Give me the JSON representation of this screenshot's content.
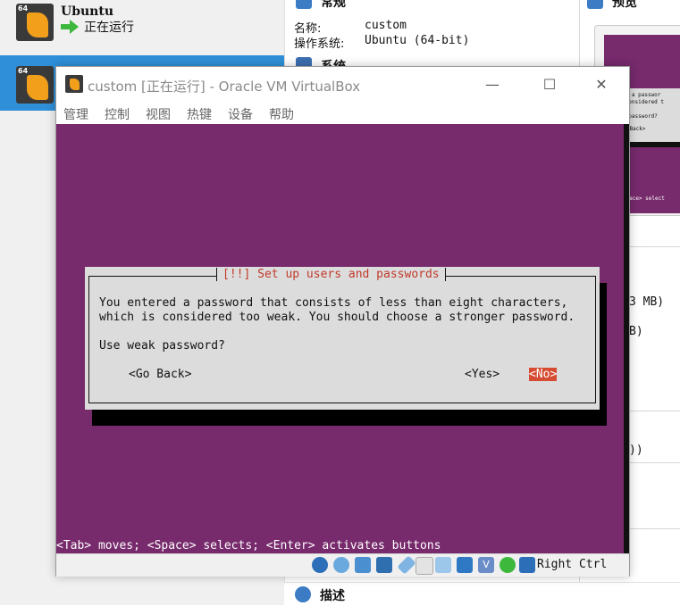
{
  "manager": {
    "vm_list": [
      {
        "name": "Ubuntu",
        "status": "正在运行",
        "badge": "64"
      },
      {
        "badge": "64"
      }
    ],
    "details": {
      "general": {
        "title": "常规",
        "name_label": "名称:",
        "name_value": "custom",
        "os_label": "操作系统:",
        "os_value": "Ubuntu (64-bit)"
      },
      "system": {
        "title": "系统"
      },
      "description": {
        "title": "描述"
      }
    },
    "preview": {
      "title": "预览",
      "thumb_lines": [
        "entered a passwor",
        "ch is considered t",
        "e weak password?",
        "<Go Back>",
        "moves; <Space> select"
      ]
    },
    "right_fragments": [
      "3 MB)",
      "B)",
      "))"
    ]
  },
  "window": {
    "title": "custom [正在运行] - Oracle VM VirtualBox",
    "controls": {
      "minimize": "—",
      "maximize": "☐",
      "close": "✕"
    },
    "menu": [
      "管理",
      "控制",
      "视图",
      "热键",
      "设备",
      "帮助"
    ]
  },
  "installer": {
    "dialog_title": "[!!] Set up users and passwords",
    "message_line1": "You entered a password that consists of less than eight characters,",
    "message_line2": "which is considered too weak. You should choose a stronger password.",
    "question": "Use weak password?",
    "buttons": {
      "go_back": "<Go Back>",
      "yes": "<Yes>",
      "no": "<No>"
    },
    "help_line": "<Tab> moves; <Space> selects; <Enter> activates buttons"
  },
  "statusbar": {
    "host_key": "Right Ctrl"
  },
  "colors": {
    "screen_bg": "#772a6c",
    "dialog_bg": "#dcdcdc",
    "dialog_title": "#c03a2a",
    "focused_button_bg": "#d64c33",
    "selected_row": "#2f8fd8"
  }
}
